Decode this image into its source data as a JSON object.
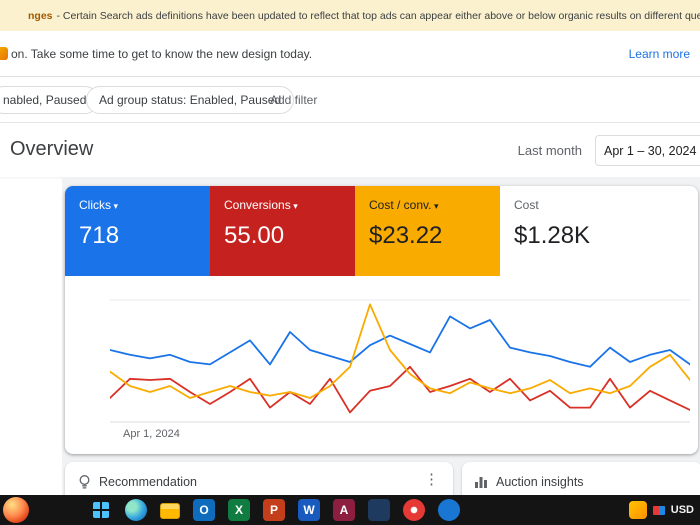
{
  "notice_bar": {
    "fragment": "nges",
    "text": "- Certain Search ads definitions have been updated to reflect that top ads can appear either above or below organic results on different queries."
  },
  "redesign_bar": {
    "text": "on. Take some time to get to know the new design today.",
    "link": "Learn more"
  },
  "filter_bar": {
    "chip_campaign": "nabled, Paused",
    "chip_adgroup": "Ad group status: Enabled, Paused",
    "add_filter": "Add filter"
  },
  "header": {
    "title": "Overview",
    "range_label": "Last month",
    "date_range": "Apr 1 – 30, 2024"
  },
  "scorecards": [
    {
      "label": "Clicks",
      "value": "718",
      "bg": "#1a73e8",
      "fg": "#ffffff",
      "caret": true
    },
    {
      "label": "Conversions",
      "value": "55.00",
      "bg": "#c5221f",
      "fg": "#ffffff",
      "caret": true
    },
    {
      "label": "Cost / conv.",
      "value": "$23.22",
      "bg": "#f9ab00",
      "fg": "#202124",
      "caret": true
    },
    {
      "label": "Cost",
      "value": "$1.28K",
      "bg": "#ffffff",
      "fg": "#202124",
      "caret": false
    }
  ],
  "chart_data": {
    "type": "line",
    "x_axis_label": "Apr 1, 2024",
    "x": [
      "Apr 1",
      "Apr 2",
      "Apr 3",
      "Apr 4",
      "Apr 5",
      "Apr 6",
      "Apr 7",
      "Apr 8",
      "Apr 9",
      "Apr 10",
      "Apr 11",
      "Apr 12",
      "Apr 13",
      "Apr 14",
      "Apr 15",
      "Apr 16",
      "Apr 17",
      "Apr 18",
      "Apr 19",
      "Apr 20",
      "Apr 21",
      "Apr 22",
      "Apr 23",
      "Apr 24",
      "Apr 25",
      "Apr 26",
      "Apr 27",
      "Apr 28",
      "Apr 29",
      "Apr 30"
    ],
    "ylim": [
      0,
      100
    ],
    "series": [
      {
        "name": "Clicks",
        "color": "#1a73e8",
        "values": [
          60,
          56,
          53,
          56,
          50,
          48,
          58,
          68,
          48,
          75,
          60,
          55,
          50,
          64,
          72,
          65,
          58,
          88,
          78,
          85,
          62,
          58,
          55,
          50,
          46,
          62,
          50,
          56,
          60,
          48
        ]
      },
      {
        "name": "Conversions",
        "color": "#d93025",
        "values": [
          20,
          36,
          35,
          36,
          25,
          15,
          25,
          36,
          12,
          25,
          15,
          36,
          8,
          26,
          30,
          46,
          25,
          30,
          36,
          25,
          36,
          18,
          26,
          12,
          12,
          36,
          12,
          26,
          18,
          10
        ]
      },
      {
        "name": "Cost / conv.",
        "color": "#f9ab00",
        "values": [
          42,
          30,
          25,
          30,
          20,
          25,
          30,
          25,
          22,
          25,
          20,
          30,
          46,
          98,
          60,
          40,
          28,
          24,
          33,
          28,
          24,
          28,
          35,
          24,
          28,
          24,
          30,
          46,
          56,
          35
        ]
      }
    ]
  },
  "bottom_cards": [
    {
      "title": "Recommendation"
    },
    {
      "title": "Auction insights"
    }
  ],
  "taskbar": {
    "currency_label": "USD",
    "icons": [
      {
        "name": "start-icon"
      },
      {
        "name": "edge-icon"
      },
      {
        "name": "file-explorer-icon"
      },
      {
        "name": "outlook-icon",
        "glyph": "O"
      },
      {
        "name": "excel-icon",
        "glyph": "X"
      },
      {
        "name": "powerpoint-icon",
        "glyph": "P"
      },
      {
        "name": "word-icon",
        "glyph": "W"
      },
      {
        "name": "access-icon",
        "glyph": "A"
      },
      {
        "name": "app-icon-navy"
      },
      {
        "name": "app-icon-red"
      },
      {
        "name": "app-icon-blue"
      }
    ]
  }
}
